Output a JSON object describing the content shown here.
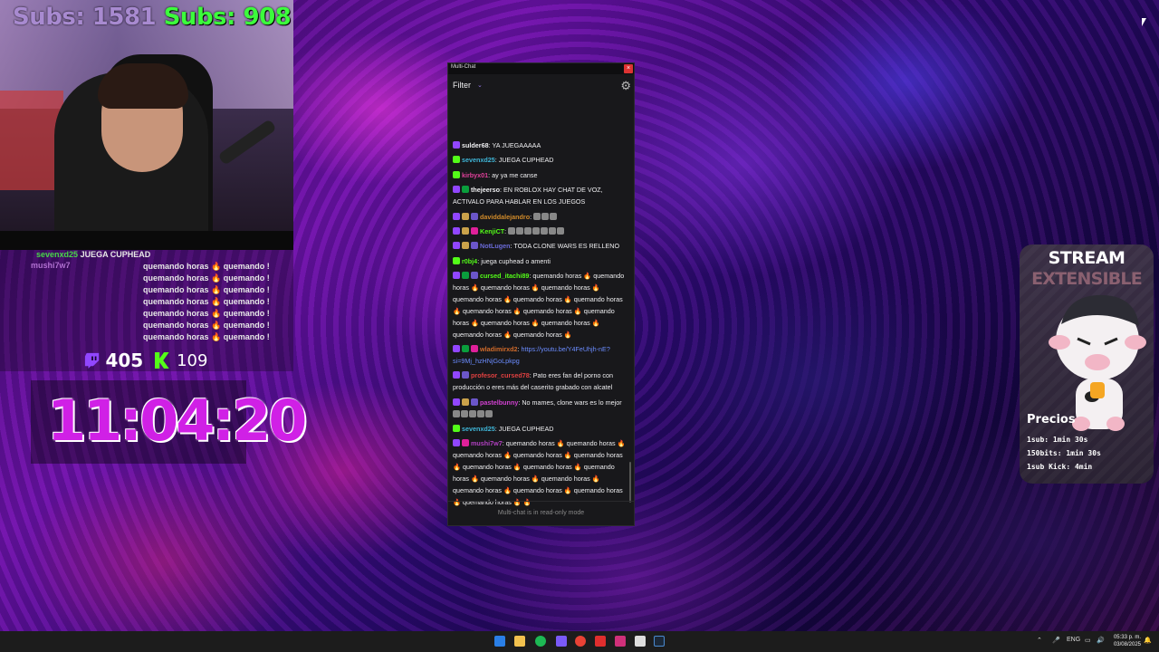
{
  "overlay": {
    "subs_left": "Subs: 1581",
    "subs_right": "Subs: 908",
    "side_chat": [
      {
        "user": "sevenxd25",
        "text": "JUEGA CUPHEAD"
      },
      {
        "user": "mushi7w7",
        "text": ""
      },
      {
        "text": "quemando horas 🔥 quemando !"
      },
      {
        "text": "quemando horas 🔥 quemando !"
      },
      {
        "text": "quemando horas 🔥 quemando !"
      },
      {
        "text": "quemando horas 🔥 quemando !"
      },
      {
        "text": "quemando horas 🔥 quemando !"
      },
      {
        "text": "quemando horas 🔥 quemando !"
      },
      {
        "text": "quemando horas 🔥 quemando !"
      }
    ],
    "twitch_count": "405",
    "kick_count": "109",
    "timer": "11:04:20"
  },
  "multichat": {
    "window_title": "Multi-Chat",
    "close_label": "×",
    "filter_label": "Filter",
    "footer": "Multi-chat is in read-only mode",
    "colors": {
      "twitch": "#9146ff",
      "kick": "#53fc18"
    },
    "messages": [
      {
        "platform": "twitch",
        "user": "sulder68",
        "user_color": "#efeff1",
        "text": "YA JUEGAAAAA"
      },
      {
        "platform": "kick",
        "user": "sevenxd25",
        "user_color": "#3fb6d8",
        "text": "JUEGA CUPHEAD"
      },
      {
        "platform": "kick",
        "user": "kirbyx01",
        "user_color": "#e0409a",
        "text": "ay ya me canse"
      },
      {
        "platform": "twitch",
        "user": "thejeerso",
        "user_color": "#efeff1",
        "text": "EN ROBLOX HAY CHAT DE VOZ, ACTIVALO PARA HABLAR EN LOS JUEGOS"
      },
      {
        "platform": "twitch",
        "user": "daviddalejandro",
        "user_color": "#d08a2a",
        "text": ""
      },
      {
        "platform": "twitch",
        "user": "KenjiCT",
        "user_color": "#53fc18",
        "text": ""
      },
      {
        "platform": "twitch",
        "user": "NotLugen",
        "user_color": "#6a6ad8",
        "text": "TODA CLONE WARS ES RELLENO"
      },
      {
        "platform": "kick",
        "user": "r0bj4",
        "user_color": "#53fc18",
        "text": "juega cuphead o amenti"
      },
      {
        "platform": "twitch",
        "user": "cursed_itachi89",
        "user_color": "#53fc18",
        "text": "quemando horas 🔥 quemando horas 🔥 quemando horas 🔥 quemando horas 🔥 quemando horas 🔥 quemando horas 🔥 quemando horas 🔥 quemando horas 🔥 quemando horas 🔥 quemando horas 🔥 quemando horas 🔥 quemando horas 🔥 quemando horas 🔥 quemando horas 🔥"
      },
      {
        "platform": "twitch",
        "user": "wladimirxd2",
        "user_color": "#d06a2a",
        "text": "",
        "link": "https://youtu.be/Y4FeUhjh-nE?si=9Mj_hzHNjGoLpkpg"
      },
      {
        "platform": "twitch",
        "user": "profesor_cursed78",
        "user_color": "#e04040",
        "text": "Pato eres fan del porno con producción o eres más del caserito grabado con alcatel"
      },
      {
        "platform": "twitch",
        "user": "pastelbunny",
        "user_color": "#d040d0",
        "text": "No mames, clone wars es lo mejor"
      },
      {
        "platform": "kick",
        "user": "sevenxd25",
        "user_color": "#3fb6d8",
        "text": "JUEGA CUPHEAD"
      },
      {
        "platform": "twitch",
        "user": "mushi7w7",
        "user_color": "#b040c0",
        "text": "quemando horas 🔥 quemando horas 🔥 quemando horas 🔥 quemando horas 🔥 quemando horas 🔥 quemando horas 🔥 quemando horas 🔥 quemando horas 🔥 quemando horas 🔥 quemando horas 🔥 quemando horas 🔥 quemando horas 🔥 quemando horas 🔥 quemando horas 🔥 🔥"
      }
    ]
  },
  "card": {
    "title1": "STREAM",
    "title2": "EXTENSIBLE",
    "prices_heading": "Precios",
    "lines": [
      "1sub: 1min 30s",
      "150bits: 1min 30s",
      "1sub Kick: 4min"
    ]
  },
  "taskbar": {
    "lang": "ENG",
    "time": "05:33 p. m.",
    "date": "03/08/2025"
  }
}
